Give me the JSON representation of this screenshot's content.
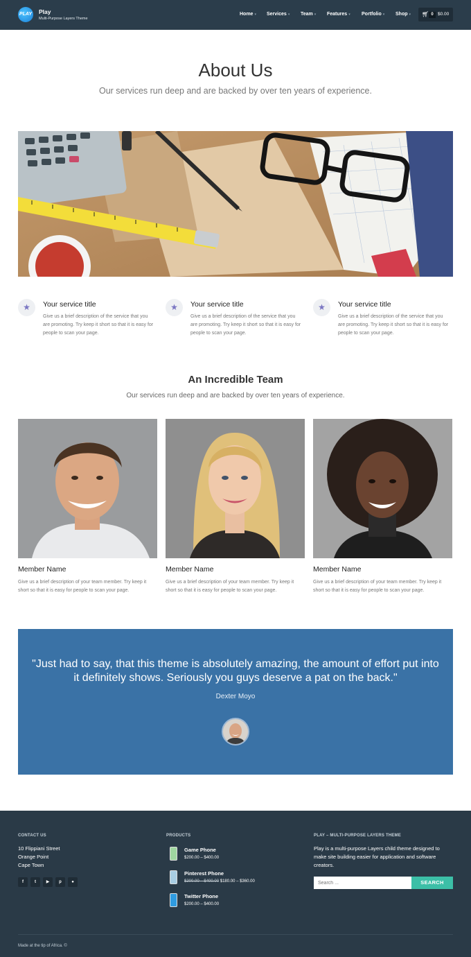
{
  "header": {
    "logo_text": "PLAY",
    "brand_name": "Play",
    "brand_tagline": "Multi-Purpose Layers Theme",
    "nav": [
      "Home",
      "Services",
      "Team",
      "Features",
      "Portfolio",
      "Shop"
    ],
    "cart_count": "0",
    "cart_total": "$0.00"
  },
  "hero": {
    "title": "About Us",
    "subtitle": "Our services run deep and are backed by over ten years of experience."
  },
  "services": [
    {
      "title": "Your service title",
      "description": "Give us a brief description of the service that you are promoting. Try keep it short so that it is easy for people to scan your page."
    },
    {
      "title": "Your service title",
      "description": "Give us a brief description of the service that you are promoting. Try keep it short so that it is easy for people to scan your page."
    },
    {
      "title": "Your service title",
      "description": "Give us a brief description of the service that you are promoting. Try keep it short so that it is easy for people to scan your page."
    }
  ],
  "team": {
    "title": "An Incredible Team",
    "subtitle": "Our services run deep and are backed by over ten years of experience.",
    "members": [
      {
        "name": "Member Name",
        "description": "Give us a brief description of your team member. Try keep it short so that it is easy for people to scan your page."
      },
      {
        "name": "Member Name",
        "description": "Give us a brief description of your team member. Try keep it short so that it is easy for people to scan your page."
      },
      {
        "name": "Member Name",
        "description": "Give us a brief description of your team member. Try keep it short so that it is easy for people to scan your page."
      }
    ]
  },
  "testimonial": {
    "quote": "\"Just had to say, that this theme is absolutely amazing, the amount of effort put into it definitely shows. Seriously you guys deserve a pat on the back.\"",
    "author": "Dexter Moyo"
  },
  "footer": {
    "contact_heading": "CONTACT US",
    "address_line1": "10 Flippiani Street",
    "address_line2": "Orange Point",
    "address_line3": "Cape Town",
    "social_icons": [
      "facebook-icon",
      "twitter-icon",
      "youtube-icon",
      "pinterest-icon",
      "dribbble-icon"
    ],
    "products_heading": "PRODUCTS",
    "products": [
      {
        "name": "Game Phone",
        "price_old": "",
        "price": "$200.00 – $400.00"
      },
      {
        "name": "Pinterest Phone",
        "price_old": "$200.00 – $400.00",
        "price": "$180.00 – $360.00"
      },
      {
        "name": "Twitter Phone",
        "price_old": "",
        "price": "$200.00 – $400.00"
      }
    ],
    "about_heading": "PLAY – MULTI-PURPOSE LAYERS THEME",
    "about_text": "Play is a multi-purpose Layers child theme designed to make site building easier for application and software creators.",
    "search_placeholder": "Search ...",
    "search_button": "SEARCH",
    "bottom_text": "Made at the tip of Africa. ©"
  },
  "colors": {
    "header_bg": "#2b3d4b",
    "testimonial_bg": "#3a72a6",
    "footer_bg": "#2a3a47",
    "accent": "#3cbfa7",
    "service_icon": "#7a76c2"
  }
}
